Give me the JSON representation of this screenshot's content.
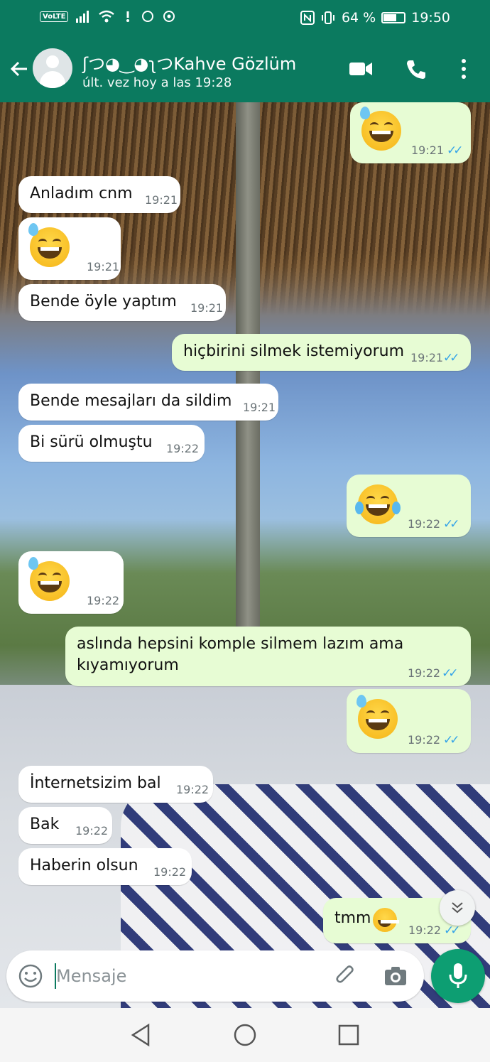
{
  "status_bar": {
    "volte": "VoLTE",
    "battery": "64 %",
    "battery_level": 0.64,
    "time": "19:50"
  },
  "header": {
    "contact_name": "ʃつ◕‿◕ʅつKahve Gözlüm",
    "last_seen": "últ. vez hoy a las 19:28"
  },
  "messages": [
    {
      "dir": "out",
      "emoji": "grin-sweat",
      "time": "19:21",
      "read": true
    },
    {
      "dir": "in",
      "text": "Anladım cnm",
      "time": "19:21"
    },
    {
      "dir": "in",
      "emoji": "grin-sweat",
      "time": "19:21"
    },
    {
      "dir": "in",
      "text": "Bende öyle yaptım",
      "time": "19:21"
    },
    {
      "dir": "out",
      "text": "hiçbirini silmek istemiyorum",
      "time": "19:21",
      "read": true
    },
    {
      "dir": "in",
      "text": "Bende mesajları da sildim",
      "time": "19:21"
    },
    {
      "dir": "in",
      "text": "Bi sürü olmuştu",
      "time": "19:22"
    },
    {
      "dir": "out",
      "emoji": "tears-of-joy",
      "time": "19:22",
      "read": true
    },
    {
      "dir": "in",
      "emoji": "grin-sweat",
      "time": "19:22"
    },
    {
      "dir": "out",
      "text": "aslında hepsini komple silmem lazım ama",
      "text2": "kıyamıyorum",
      "time": "19:22",
      "read": true
    },
    {
      "dir": "out",
      "emoji": "grin-sweat",
      "time": "19:22",
      "read": true
    },
    {
      "dir": "in",
      "text": "İnternetsizim bal",
      "time": "19:22"
    },
    {
      "dir": "in",
      "text": "Bak",
      "time": "19:22"
    },
    {
      "dir": "in",
      "text": "Haberin olsun",
      "time": "19:22"
    },
    {
      "dir": "out",
      "text": "tmm",
      "emoji": "tears-of-joy",
      "time": "19:22",
      "read": true
    }
  ],
  "composer": {
    "placeholder": "Mensaje"
  },
  "colors": {
    "brand": "#0b7a5f",
    "outgoing": "#e7fcd4",
    "incoming": "#ffffff",
    "read_ticks": "#35a4e8",
    "mic": "#0d9e72"
  },
  "icons": [
    "back-arrow-icon",
    "video-call-icon",
    "phone-icon",
    "more-vert-icon",
    "emoji-icon",
    "attach-icon",
    "camera-icon",
    "mic-icon",
    "scroll-down-icon",
    "nav-back-icon",
    "nav-home-icon",
    "nav-recents-icon"
  ]
}
